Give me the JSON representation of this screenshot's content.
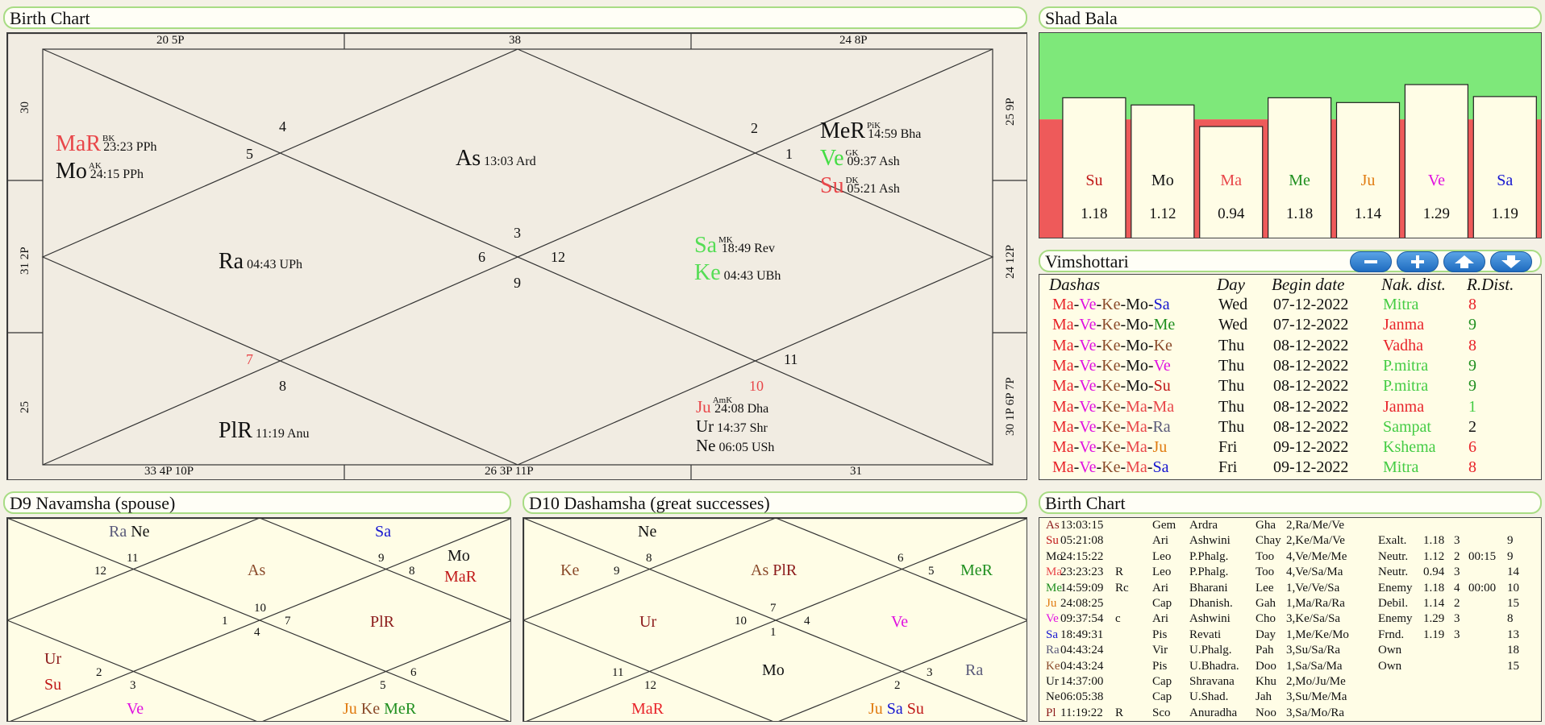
{
  "titles": {
    "birth_chart": "Birth Chart",
    "shad_bala": "Shad Bala",
    "vimshottari": "Vimshottari",
    "navamsha": "D9 Navamsha  (spouse)",
    "dashamsha": "D10 Dashamsha  (great successes)",
    "birth_chart_table": "Birth Chart"
  },
  "colors": {
    "red": "#e8474a",
    "dark_red": "#b01818",
    "green": "#1f8f1f",
    "light_green": "#44cc44",
    "orange": "#e07b10",
    "magenta": "#e010e0",
    "blue": "#1515d0",
    "slate": "#5a5a7a",
    "brown": "#8a4a2a",
    "maroon": "#8b1a1a"
  },
  "main_chart": {
    "edge": {
      "top_left": "20  5P",
      "top_mid": "38",
      "top_right": "24  8P",
      "bottom_left": "33  4P 10P",
      "bottom_mid": "26  3P 11P",
      "bottom_right": "31",
      "left_top": "30",
      "left_mid": "31  2P",
      "left_bottom": "25",
      "right_top": "25  9P",
      "right_mid": "24  12P",
      "right_bottom": "30  1P 6P 7P"
    },
    "houses": [
      "4",
      "5",
      "2",
      "1",
      "3",
      "6",
      "12",
      "9",
      "7",
      "8",
      "11",
      "10"
    ],
    "asc": {
      "name": "As",
      "deg": "13:03 Ard"
    },
    "planets": {
      "mar": {
        "name": "MaR",
        "sup": "BK",
        "deg": "23:23 PPh"
      },
      "mo": {
        "name": "Mo",
        "sup": "AK",
        "deg": "24:15 PPh"
      },
      "mer": {
        "name": "MeR",
        "sup": "PiK",
        "deg": "14:59 Bha"
      },
      "ve": {
        "name": "Ve",
        "sup": "GK",
        "deg": "09:37 Ash"
      },
      "su": {
        "name": "Su",
        "sup": "DK",
        "deg": "05:21 Ash"
      },
      "ra": {
        "name": "Ra",
        "deg": "04:43 UPh"
      },
      "sa": {
        "name": "Sa",
        "sup": "MK",
        "deg": "18:49 Rev"
      },
      "ke": {
        "name": "Ke",
        "deg": "04:43 UBh"
      },
      "plr": {
        "name": "PlR",
        "deg": "11:19 Anu"
      },
      "ju": {
        "name": "Ju",
        "sup": "AmK",
        "deg": "24:08 Dha"
      },
      "ur": {
        "name": "Ur",
        "deg": "14:37 Shr"
      },
      "ne": {
        "name": "Ne",
        "deg": "06:05 USh"
      }
    }
  },
  "shad_bala": [
    {
      "name": "Su",
      "value": 1.18,
      "label": "1.18",
      "color": "#c01818"
    },
    {
      "name": "Mo",
      "value": 1.12,
      "label": "1.12",
      "color": "#111111"
    },
    {
      "name": "Ma",
      "value": 0.94,
      "label": "0.94",
      "color": "#e8474a"
    },
    {
      "name": "Me",
      "value": 1.18,
      "label": "1.18",
      "color": "#1f8f1f"
    },
    {
      "name": "Ju",
      "value": 1.14,
      "label": "1.14",
      "color": "#e07b10"
    },
    {
      "name": "Ve",
      "value": 1.29,
      "label": "1.29",
      "color": "#e010e0"
    },
    {
      "name": "Sa",
      "value": 1.19,
      "label": "1.19",
      "color": "#1515d0"
    }
  ],
  "vimshottari": {
    "headers": {
      "dashas": "Dashas",
      "day": "Day",
      "begin": "Begin date",
      "nak": "Nak. dist.",
      "rdist": "R.Dist."
    },
    "rows": [
      {
        "d1": "Ma",
        "d2": "Ve",
        "d3": "Ke",
        "d4": "Mo",
        "d5": "Sa",
        "c4": "#111111",
        "c5": "#1515d0",
        "day": "Wed",
        "date": "07-12-2022",
        "nak": "Mitra",
        "nakc": "#44cc44",
        "r": "8",
        "rc": "#e8242a"
      },
      {
        "d1": "Ma",
        "d2": "Ve",
        "d3": "Ke",
        "d4": "Mo",
        "d5": "Me",
        "c4": "#111111",
        "c5": "#1f8f1f",
        "day": "Wed",
        "date": "07-12-2022",
        "nak": "Janma",
        "nakc": "#e8242a",
        "r": "9",
        "rc": "#1f8f1f"
      },
      {
        "d1": "Ma",
        "d2": "Ve",
        "d3": "Ke",
        "d4": "Mo",
        "d5": "Ke",
        "c4": "#111111",
        "c5": "#8a4a2a",
        "day": "Thu",
        "date": "08-12-2022",
        "nak": "Vadha",
        "nakc": "#e8242a",
        "r": "8",
        "rc": "#e8242a"
      },
      {
        "d1": "Ma",
        "d2": "Ve",
        "d3": "Ke",
        "d4": "Mo",
        "d5": "Ve",
        "c4": "#111111",
        "c5": "#e010e0",
        "day": "Thu",
        "date": "08-12-2022",
        "nak": "P.mitra",
        "nakc": "#44cc44",
        "r": "9",
        "rc": "#1f8f1f"
      },
      {
        "d1": "Ma",
        "d2": "Ve",
        "d3": "Ke",
        "d4": "Mo",
        "d5": "Su",
        "c4": "#111111",
        "c5": "#c01818",
        "day": "Thu",
        "date": "08-12-2022",
        "nak": "P.mitra",
        "nakc": "#44cc44",
        "r": "9",
        "rc": "#1f8f1f"
      },
      {
        "d1": "Ma",
        "d2": "Ve",
        "d3": "Ke",
        "d4": "Ma",
        "d5": "Ma",
        "c4": "#e8474a",
        "c5": "#e8474a",
        "day": "Thu",
        "date": "08-12-2022",
        "nak": "Janma",
        "nakc": "#e8242a",
        "r": "1",
        "rc": "#44cc44"
      },
      {
        "d1": "Ma",
        "d2": "Ve",
        "d3": "Ke",
        "d4": "Ma",
        "d5": "Ra",
        "c4": "#e8474a",
        "c5": "#5a5a7a",
        "day": "Thu",
        "date": "08-12-2022",
        "nak": "Sampat",
        "nakc": "#44cc44",
        "r": "2",
        "rc": "#111111"
      },
      {
        "d1": "Ma",
        "d2": "Ve",
        "d3": "Ke",
        "d4": "Ma",
        "d5": "Ju",
        "c4": "#e8474a",
        "c5": "#e07b10",
        "day": "Fri",
        "date": "09-12-2022",
        "nak": "Kshema",
        "nakc": "#44cc44",
        "r": "6",
        "rc": "#e8242a"
      },
      {
        "d1": "Ma",
        "d2": "Ve",
        "d3": "Ke",
        "d4": "Ma",
        "d5": "Sa",
        "c4": "#e8474a",
        "c5": "#1515d0",
        "day": "Fri",
        "date": "09-12-2022",
        "nak": "Mitra",
        "nakc": "#44cc44",
        "r": "8",
        "rc": "#e8242a"
      }
    ]
  },
  "navamsha": {
    "houses": [
      "11",
      "12",
      "9",
      "8",
      "10",
      "1",
      "7",
      "4",
      "2",
      "3",
      "5",
      "6"
    ],
    "planets": {
      "ra": "Ra",
      "ne": "Ne",
      "sa": "Sa",
      "as": "As",
      "mo": "Mo",
      "mar": "MaR",
      "plr": "PlR",
      "ur": "Ur",
      "su": "Su",
      "ve": "Ve",
      "ju": "Ju",
      "ke": "Ke",
      "mer": "MeR"
    }
  },
  "dashamsha": {
    "houses": [
      "8",
      "9",
      "6",
      "5",
      "7",
      "10",
      "4",
      "1",
      "11",
      "12",
      "2",
      "3"
    ],
    "planets": {
      "ne": "Ne",
      "ke": "Ke",
      "as": "As",
      "plr": "PlR",
      "mer": "MeR",
      "ur": "Ur",
      "ve": "Ve",
      "mo": "Mo",
      "ra": "Ra",
      "mar": "MaR",
      "ju": "Ju",
      "sa": "Sa",
      "su": "Su"
    }
  },
  "birth_table": [
    {
      "p": "As",
      "pc": "#8b1a1a",
      "deg": "13:03:15",
      "r": "",
      "sign": "Gem",
      "nak": "Ardra",
      "pada": "Gha",
      "lords": "2,Ra/Me/Ve",
      "dig": "",
      "val": "",
      "n1": "",
      "n2": "",
      "n3": ""
    },
    {
      "p": "Su",
      "pc": "#c01818",
      "deg": "05:21:08",
      "r": "",
      "sign": "Ari",
      "nak": "Ashwini",
      "pada": "Chay",
      "lords": "2,Ke/Ma/Ve",
      "dig": "Exalt.",
      "val": "1.18",
      "n1": "3",
      "n2": "",
      "n3": "9"
    },
    {
      "p": "Mo",
      "pc": "#111111",
      "deg": "24:15:22",
      "r": "",
      "sign": "Leo",
      "nak": "P.Phalg.",
      "pada": "Too",
      "lords": "4,Ve/Me/Me",
      "dig": "Neutr.",
      "val": "1.12",
      "n1": "2",
      "n2": "00:15",
      "n3": "9"
    },
    {
      "p": "Ma",
      "pc": "#e8474a",
      "deg": "23:23:23",
      "r": "R",
      "sign": "Leo",
      "nak": "P.Phalg.",
      "pada": "Too",
      "lords": "4,Ve/Sa/Ma",
      "dig": "Neutr.",
      "val": "0.94",
      "n1": "3",
      "n2": "",
      "n3": "14"
    },
    {
      "p": "Me",
      "pc": "#1f8f1f",
      "deg": "14:59:09",
      "r": "Rc",
      "sign": "Ari",
      "nak": "Bharani",
      "pada": "Lee",
      "lords": "1,Ve/Ve/Sa",
      "dig": "Enemy",
      "val": "1.18",
      "n1": "4",
      "n2": "00:00",
      "n3": "10"
    },
    {
      "p": "Ju",
      "pc": "#e07b10",
      "deg": "24:08:25",
      "r": "",
      "sign": "Cap",
      "nak": "Dhanish.",
      "pada": "Gah",
      "lords": "1,Ma/Ra/Ra",
      "dig": "Debil.",
      "val": "1.14",
      "n1": "2",
      "n2": "",
      "n3": "15"
    },
    {
      "p": "Ve",
      "pc": "#e010e0",
      "deg": "09:37:54",
      "r": "c",
      "sign": "Ari",
      "nak": "Ashwini",
      "pada": "Cho",
      "lords": "3,Ke/Sa/Sa",
      "dig": "Enemy",
      "val": "1.29",
      "n1": "3",
      "n2": "",
      "n3": "8"
    },
    {
      "p": "Sa",
      "pc": "#1515d0",
      "deg": "18:49:31",
      "r": "",
      "sign": "Pis",
      "nak": "Revati",
      "pada": "Day",
      "lords": "1,Me/Ke/Mo",
      "dig": "Frnd.",
      "val": "1.19",
      "n1": "3",
      "n2": "",
      "n3": "13"
    },
    {
      "p": "Ra",
      "pc": "#5a5a7a",
      "deg": "04:43:24",
      "r": "",
      "sign": "Vir",
      "nak": "U.Phalg.",
      "pada": "Pah",
      "lords": "3,Su/Sa/Ra",
      "dig": "Own",
      "val": "",
      "n1": "",
      "n2": "",
      "n3": "18"
    },
    {
      "p": "Ke",
      "pc": "#8a4a2a",
      "deg": "04:43:24",
      "r": "",
      "sign": "Pis",
      "nak": "U.Bhadra.",
      "pada": "Doo",
      "lords": "1,Sa/Sa/Ma",
      "dig": "Own",
      "val": "",
      "n1": "",
      "n2": "",
      "n3": "15"
    },
    {
      "p": "Ur",
      "pc": "#111111",
      "deg": "14:37:00",
      "r": "",
      "sign": "Cap",
      "nak": "Shravana",
      "pada": "Khu",
      "lords": "2,Mo/Ju/Me",
      "dig": "",
      "val": "",
      "n1": "",
      "n2": "",
      "n3": ""
    },
    {
      "p": "Ne",
      "pc": "#111111",
      "deg": "06:05:38",
      "r": "",
      "sign": "Cap",
      "nak": "U.Shad.",
      "pada": "Jah",
      "lords": "3,Su/Me/Ma",
      "dig": "",
      "val": "",
      "n1": "",
      "n2": "",
      "n3": ""
    },
    {
      "p": "Pl",
      "pc": "#8b1a1a",
      "deg": "11:19:22",
      "r": "R",
      "sign": "Sco",
      "nak": "Anuradha",
      "pada": "Noo",
      "lords": "3,Sa/Mo/Ra",
      "dig": "",
      "val": "",
      "n1": "",
      "n2": "",
      "n3": ""
    }
  ]
}
